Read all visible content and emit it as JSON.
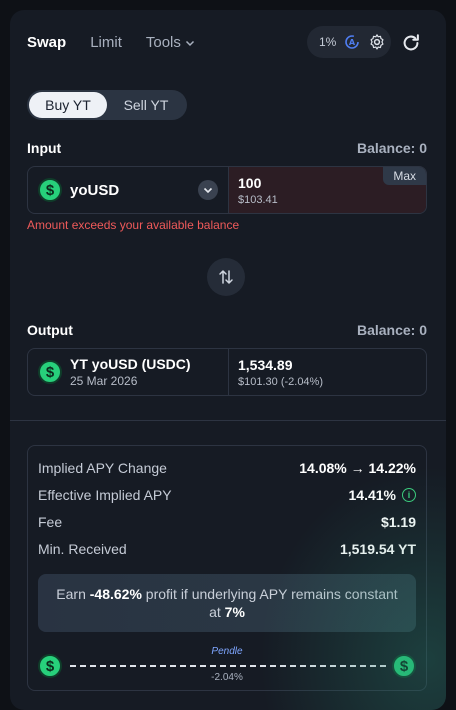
{
  "header": {
    "tabs": [
      "Swap",
      "Limit",
      "Tools"
    ],
    "slippage": "1%"
  },
  "mode": {
    "buy_label": "Buy YT",
    "sell_label": "Sell YT",
    "selected": "Buy YT"
  },
  "input": {
    "label": "Input",
    "balance": "Balance: 0",
    "token": "yoUSD",
    "amount": "100",
    "amount_usd": "$103.41",
    "max_label": "Max",
    "error": "Amount exceeds your available balance"
  },
  "output": {
    "label": "Output",
    "balance": "Balance: 0",
    "token": "YT yoUSD (USDC)",
    "maturity": "25 Mar 2026",
    "amount": "1,534.89",
    "amount_usd": "$101.30 (-2.04%)"
  },
  "details": {
    "rows": [
      {
        "key": "Implied APY Change",
        "value": "14.08% → 14.22%"
      },
      {
        "key": "Effective Implied APY",
        "value": "14.41%"
      },
      {
        "key": "Fee",
        "value": "$1.19"
      },
      {
        "key": "Min. Received",
        "value": "1,519.54 YT"
      }
    ],
    "earn_prefix": "Earn ",
    "earn_value": "-48.62%",
    "earn_mid": " profit if underlying APY remains constant at ",
    "earn_apy": "7%",
    "route_label": "Pendle",
    "route_pct": "-2.04%"
  },
  "colors": {
    "accent_green": "#27d07b",
    "error_red": "#ef5a5a",
    "route_blue": "#7ea6ff"
  },
  "icons": {
    "coin": "dollar-icon",
    "settings": "gear-icon",
    "refresh": "refresh-icon",
    "swap": "swap-arrows-icon"
  }
}
